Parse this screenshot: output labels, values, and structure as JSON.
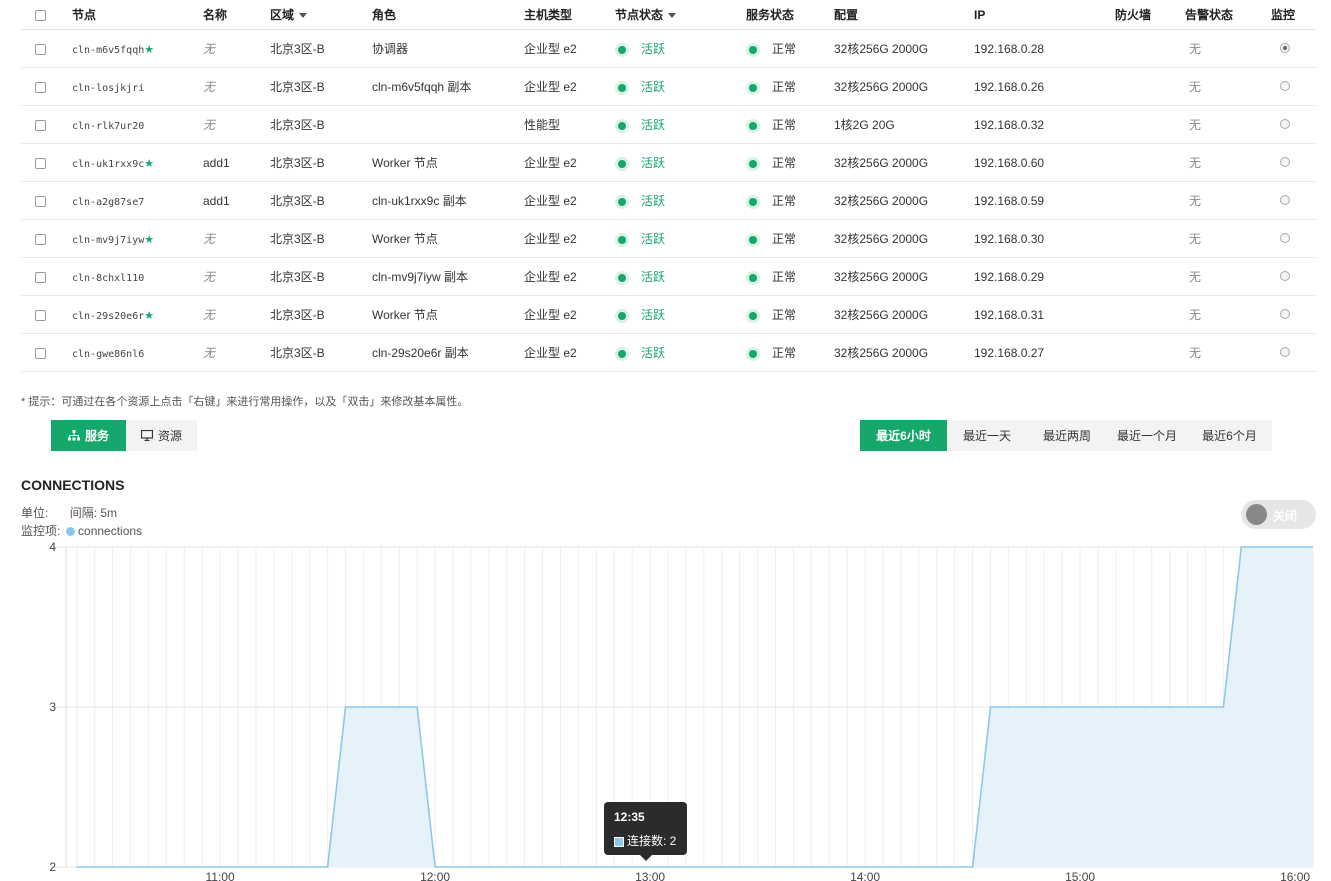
{
  "table": {
    "headers": {
      "node": "节点",
      "name": "名称",
      "zone": "区域",
      "role": "角色",
      "host_type": "主机类型",
      "node_status": "节点状态",
      "service_status": "服务状态",
      "config": "配置",
      "ip": "IP",
      "firewall": "防火墙",
      "alert_status": "告警状态",
      "monitor": "监控"
    },
    "rows": [
      {
        "node": "cln-m6v5fqqh",
        "star": true,
        "name": "无",
        "zone": "北京3区-B",
        "role": "协调器",
        "host_type": "企业型 e2",
        "node_status": "活跃",
        "service_status": "正常",
        "config": "32核256G 2000G",
        "ip": "192.168.0.28",
        "alert": "无",
        "monitor_selected": true
      },
      {
        "node": "cln-losjkjri",
        "star": false,
        "name": "无",
        "zone": "北京3区-B",
        "role": "cln-m6v5fqqh 副本",
        "host_type": "企业型 e2",
        "node_status": "活跃",
        "service_status": "正常",
        "config": "32核256G 2000G",
        "ip": "192.168.0.26",
        "alert": "无",
        "monitor_selected": false
      },
      {
        "node": "cln-rlk7ur20",
        "star": false,
        "name": "无",
        "zone": "北京3区-B",
        "role": "",
        "host_type": "性能型",
        "node_status": "活跃",
        "service_status": "正常",
        "config": "1核2G 20G",
        "ip": "192.168.0.32",
        "alert": "无",
        "monitor_selected": false
      },
      {
        "node": "cln-uk1rxx9c",
        "star": true,
        "name": "add1",
        "zone": "北京3区-B",
        "role": "Worker 节点",
        "host_type": "企业型 e2",
        "node_status": "活跃",
        "service_status": "正常",
        "config": "32核256G 2000G",
        "ip": "192.168.0.60",
        "alert": "无",
        "monitor_selected": false
      },
      {
        "node": "cln-a2g87se7",
        "star": false,
        "name": "add1",
        "zone": "北京3区-B",
        "role": "cln-uk1rxx9c 副本",
        "host_type": "企业型 e2",
        "node_status": "活跃",
        "service_status": "正常",
        "config": "32核256G 2000G",
        "ip": "192.168.0.59",
        "alert": "无",
        "monitor_selected": false
      },
      {
        "node": "cln-mv9j7iyw",
        "star": true,
        "name": "无",
        "zone": "北京3区-B",
        "role": "Worker 节点",
        "host_type": "企业型 e2",
        "node_status": "活跃",
        "service_status": "正常",
        "config": "32核256G 2000G",
        "ip": "192.168.0.30",
        "alert": "无",
        "monitor_selected": false
      },
      {
        "node": "cln-8chxl110",
        "star": false,
        "name": "无",
        "zone": "北京3区-B",
        "role": "cln-mv9j7iyw 副本",
        "host_type": "企业型 e2",
        "node_status": "活跃",
        "service_status": "正常",
        "config": "32核256G 2000G",
        "ip": "192.168.0.29",
        "alert": "无",
        "monitor_selected": false
      },
      {
        "node": "cln-29s20e6r",
        "star": true,
        "name": "无",
        "zone": "北京3区-B",
        "role": "Worker 节点",
        "host_type": "企业型 e2",
        "node_status": "活跃",
        "service_status": "正常",
        "config": "32核256G 2000G",
        "ip": "192.168.0.31",
        "alert": "无",
        "monitor_selected": false
      },
      {
        "node": "cln-gwe86nl6",
        "star": false,
        "name": "无",
        "zone": "北京3区-B",
        "role": "cln-29s20e6r 副本",
        "host_type": "企业型 e2",
        "node_status": "活跃",
        "service_status": "正常",
        "config": "32核256G 2000G",
        "ip": "192.168.0.27",
        "alert": "无",
        "monitor_selected": false
      }
    ]
  },
  "tip": "* 提示：可通过在各个资源上点击「右键」来进行常用操作，以及「双击」来修改基本属性。",
  "view_tabs": {
    "service": "服务",
    "resource": "资源"
  },
  "time_ranges": [
    "最近6小时",
    "最近一天",
    "最近两周",
    "最近一个月",
    "最近6个月"
  ],
  "active_range": 0,
  "chart_header": {
    "title": "CONNECTIONS",
    "unit_label": "单位:",
    "interval": "间隔: 5m",
    "metric_label": "监控项:",
    "metric_name": "connections",
    "toggle_label": "关闭"
  },
  "tooltip": {
    "time": "12:35",
    "value_text": "连接数: 2"
  },
  "colors": {
    "accent": "#16a76b",
    "series_line": "#8ec8e8",
    "series_fill": "#e6f2fa"
  },
  "chart_data": {
    "type": "area",
    "title": "CONNECTIONS",
    "series": [
      {
        "name": "connections"
      }
    ],
    "x": [
      "10:20",
      "10:25",
      "10:30",
      "10:35",
      "10:40",
      "10:45",
      "10:50",
      "10:55",
      "11:00",
      "11:05",
      "11:10",
      "11:15",
      "11:20",
      "11:25",
      "11:30",
      "11:35",
      "11:40",
      "11:45",
      "11:50",
      "11:55",
      "12:00",
      "12:05",
      "12:10",
      "12:15",
      "12:20",
      "12:25",
      "12:30",
      "12:35",
      "12:40",
      "12:45",
      "12:50",
      "12:55",
      "13:00",
      "13:05",
      "13:10",
      "13:15",
      "13:20",
      "13:25",
      "13:30",
      "13:35",
      "13:40",
      "13:45",
      "13:50",
      "13:55",
      "14:00",
      "14:05",
      "14:10",
      "14:15",
      "14:20",
      "14:25",
      "14:30",
      "14:35",
      "14:40",
      "14:45",
      "14:50",
      "14:55",
      "15:00",
      "15:05",
      "15:10",
      "15:15",
      "15:20",
      "15:25",
      "15:30",
      "15:35",
      "15:40",
      "15:45",
      "15:50",
      "15:55",
      "16:00",
      "16:05"
    ],
    "values": [
      2,
      2,
      2,
      2,
      2,
      2,
      2,
      2,
      2,
      2,
      2,
      2,
      2,
      2,
      2,
      3,
      3,
      3,
      3,
      3,
      2,
      2,
      2,
      2,
      2,
      2,
      2,
      2,
      2,
      2,
      2,
      2,
      2,
      2,
      2,
      2,
      2,
      2,
      2,
      2,
      2,
      2,
      2,
      2,
      2,
      2,
      2,
      2,
      2,
      2,
      2,
      3,
      3,
      3,
      3,
      3,
      3,
      3,
      3,
      3,
      3,
      3,
      3,
      3,
      3,
      4,
      4,
      4,
      4,
      4,
      4
    ],
    "x_ticks": [
      "11:00",
      "12:00",
      "13:00",
      "14:00",
      "15:00",
      "16:00"
    ],
    "ylim": [
      2,
      4
    ],
    "y_ticks": [
      2,
      3,
      4
    ],
    "grid": true
  }
}
